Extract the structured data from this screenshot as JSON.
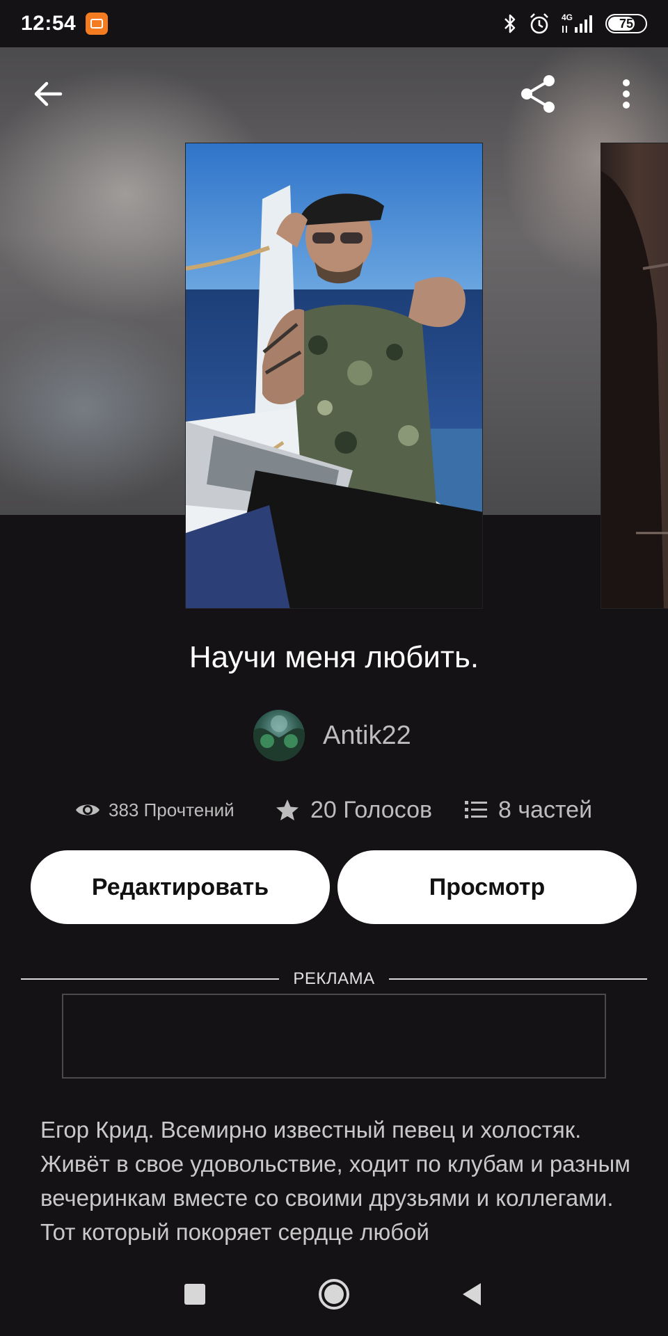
{
  "status_bar": {
    "time": "12:54",
    "network": "4G",
    "battery": "75",
    "battery_level": 0.75
  },
  "toolbar": {
    "back_icon": "arrow-left-icon",
    "share_icon": "share-icon",
    "menu_icon": "more-vertical-icon"
  },
  "story": {
    "title": "Научи меня любить.",
    "author": "Antik22",
    "stats": {
      "reads": "383 Прочтений",
      "votes": "20 Голосов",
      "parts": "8 частей"
    },
    "description": "Егор Крид. Всемирно известный певец и холостяк. Живёт в свое удовольствие, ходит по клубам и разным вечеринкам вместе со своими друзьями и коллегами. Тот который покоряет сердце любой"
  },
  "actions": {
    "edit_label": "Редактировать",
    "view_label": "Просмотр"
  },
  "ad": {
    "label": "РЕКЛАМА"
  },
  "colors": {
    "background": "#141215",
    "button": "#ffffff",
    "secondary_text": "#bdbdbd",
    "badge": "#f47b20"
  }
}
